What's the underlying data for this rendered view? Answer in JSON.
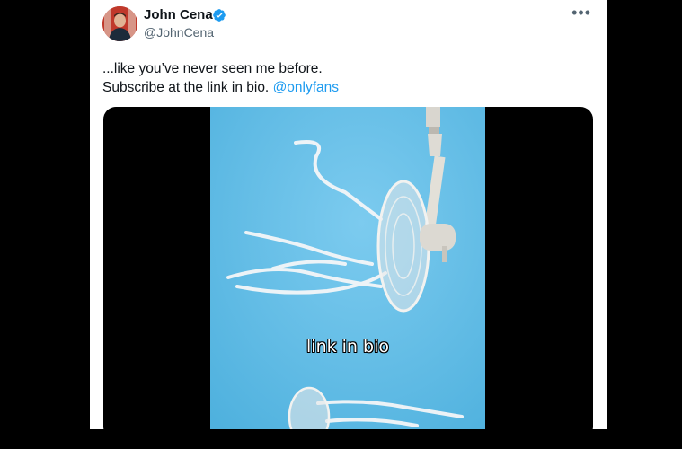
{
  "tweet": {
    "author_name": "John Cena",
    "handle": "@JohnCena",
    "verified": true,
    "more_icon": "more-horizontal-icon",
    "text_line1": "...like you’ve never seen me before.",
    "text_line2": "Subscribe at the link in bio.",
    "mention": "@onlyfans",
    "media_caption": "link in bio"
  },
  "colors": {
    "verified_badge": "#1d9bf0",
    "mention": "#1d9bf0",
    "video_background": "#5bb8e0",
    "letterbox": "#000000"
  }
}
